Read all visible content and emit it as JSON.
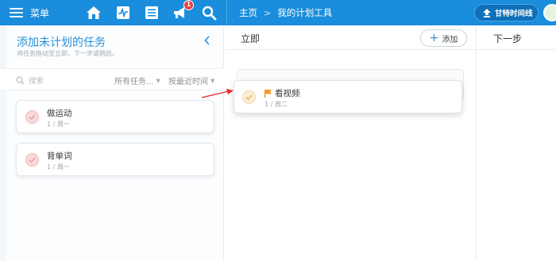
{
  "topbar": {
    "menu_label": "菜单",
    "icons": [
      "home-icon",
      "activity-icon",
      "list-icon",
      "megaphone-icon",
      "search-icon"
    ],
    "notification_count": "1",
    "breadcrumb": [
      "主页",
      "我的计划工具"
    ],
    "gantt_label": "甘特时间线",
    "accent": "#1a8ddc"
  },
  "left_panel": {
    "title": "添加未计划的任务",
    "subtitle": "将任务拖动至立即、下一步或稍后。",
    "search_placeholder": "搜索",
    "filter_label": "所有任务...",
    "sort_label": "按最近时间",
    "tasks": [
      {
        "name": "做运动",
        "meta": "1 / 周一"
      },
      {
        "name": "背单词",
        "meta": "1 / 周一"
      }
    ]
  },
  "board": {
    "columns": [
      {
        "title": "立即",
        "add_label": "添加"
      },
      {
        "title": "下一步"
      }
    ],
    "dragging_task": {
      "name": "看视频",
      "meta": "1 / 周二"
    }
  }
}
